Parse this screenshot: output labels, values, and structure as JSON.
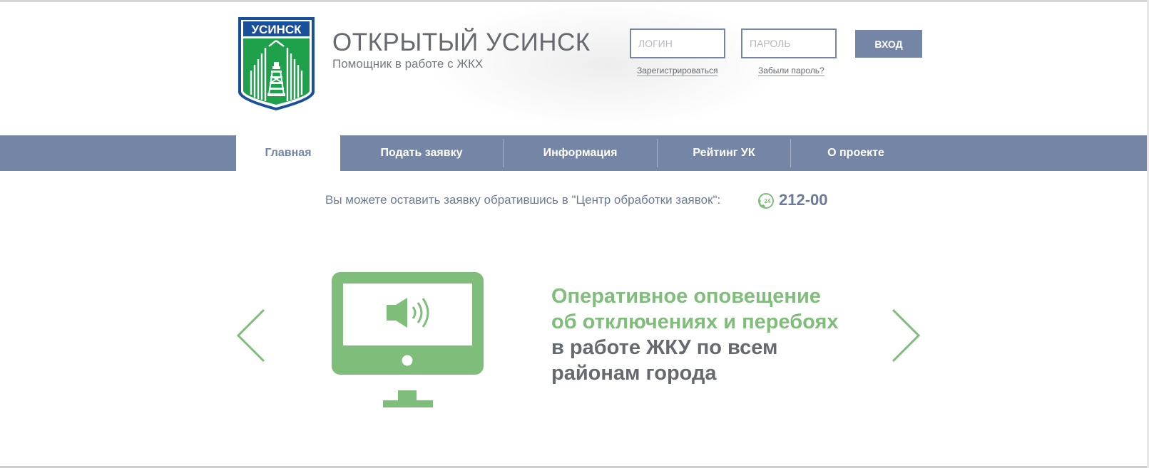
{
  "header": {
    "logo_text": "УСИНСК",
    "title": "ОТКРЫТЫЙ УСИНСК",
    "subtitle": "Помощник в работе с ЖКХ"
  },
  "auth": {
    "login_placeholder": "ЛОГИН",
    "password_placeholder": "ПАРОЛЬ",
    "login_button": "ВХОД",
    "register_link": "Зарегистрироваться",
    "forgot_link": "Забыли пароль?"
  },
  "nav": {
    "items": [
      {
        "label": "Главная",
        "active": true
      },
      {
        "label": "Подать заявку"
      },
      {
        "label": "Информация"
      },
      {
        "label": "Рейтинг УК"
      },
      {
        "label": "О проекте"
      }
    ]
  },
  "info": {
    "text": "Вы можете оставить заявку обратившись в \"Центр обработки заявок\":",
    "phone_badge": "24",
    "phone": "212-00"
  },
  "slider": {
    "line1": "Оперативное оповещение",
    "line2": "об отключениях и перебоях",
    "line3": "в работе ЖКУ по всем",
    "line4": "районам города",
    "prev_icon": "chevron-left-icon",
    "next_icon": "chevron-right-icon",
    "slide_icon": "monitor-speaker-icon"
  },
  "colors": {
    "nav": "#7585a5",
    "accent_green": "#7fbd7a",
    "logo_blue": "#1a4f9c",
    "logo_green": "#1fa04a",
    "text_gray": "#666a70"
  }
}
